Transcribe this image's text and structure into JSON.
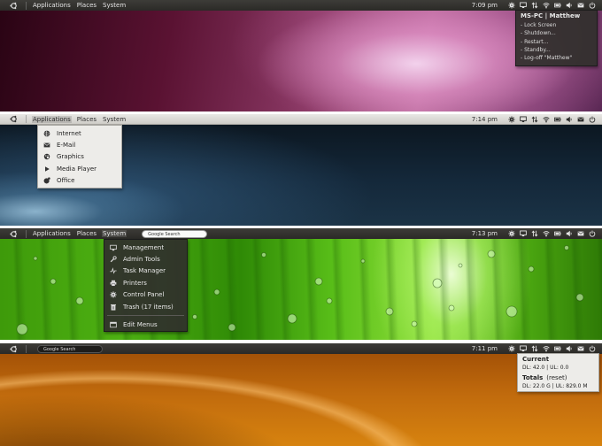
{
  "panels": [
    {
      "theme": "dark",
      "menus": [
        "Applications",
        "Places",
        "System"
      ],
      "clock": "7:09 pm",
      "wallpaper_colors": [
        "#3a0a1e",
        "#7a2556",
        "#c86fa6",
        "#e8b8d8"
      ],
      "popup": {
        "title": "MS-PC | Matthew",
        "items": [
          "- Lock Screen",
          "- Shutdown...",
          "- Restart...",
          "- Standby...",
          "- Log-off  \"Matthew\""
        ]
      }
    },
    {
      "theme": "light",
      "menus": [
        "Applications",
        "Places",
        "System"
      ],
      "clock": "7:14 pm",
      "wallpaper_colors": [
        "#0f1b26",
        "#1d3447",
        "#6b93b0"
      ],
      "dropdown": [
        {
          "icon": "globe-icon",
          "label": "Internet"
        },
        {
          "icon": "envelope-icon",
          "label": "E-Mail"
        },
        {
          "icon": "graphics-icon",
          "label": "Graphics"
        },
        {
          "icon": "play-icon",
          "label": "Media Player"
        },
        {
          "icon": "office-icon",
          "label": "Office"
        }
      ]
    },
    {
      "theme": "dark",
      "menus": [
        "Applications",
        "Places",
        "System"
      ],
      "active_menu": "System",
      "search_placeholder": "Google Search",
      "clock": "7:13 pm",
      "wallpaper_colors": [
        "#1f5e06",
        "#4fb012",
        "#9fe83a",
        "#e6ffd0"
      ],
      "dropdown": [
        {
          "icon": "management-icon",
          "label": "Management"
        },
        {
          "icon": "wrench-icon",
          "label": "Admin Tools"
        },
        {
          "icon": "task-manager-icon",
          "label": "Task Manager"
        },
        {
          "icon": "printer-icon",
          "label": "Printers"
        },
        {
          "icon": "control-panel-icon",
          "label": "Control Panel"
        },
        {
          "icon": "trash-icon",
          "label": "Trash (17 items)"
        }
      ],
      "dropdown_footer": {
        "icon": "edit-menus-icon",
        "label": "Edit Menus"
      }
    },
    {
      "theme": "dark",
      "search_placeholder": "Google Search",
      "clock": "7:11 pm",
      "wallpaper_colors": [
        "#3b1702",
        "#9a4a06",
        "#d88410",
        "#f3b84a"
      ],
      "popup": {
        "current_title": "Current",
        "current_line": "DL: 42.0  | UL: 0.0",
        "totals_title": "Totals",
        "totals_reset": "(reset)",
        "totals_line": "DL: 22.0 G | UL: 829.0 M"
      }
    }
  ],
  "tray_icons": [
    "settings-icon",
    "monitor-icon",
    "network-arrows-icon",
    "wifi-icon",
    "battery-icon",
    "volume-icon",
    "mail-icon",
    "power-icon"
  ]
}
